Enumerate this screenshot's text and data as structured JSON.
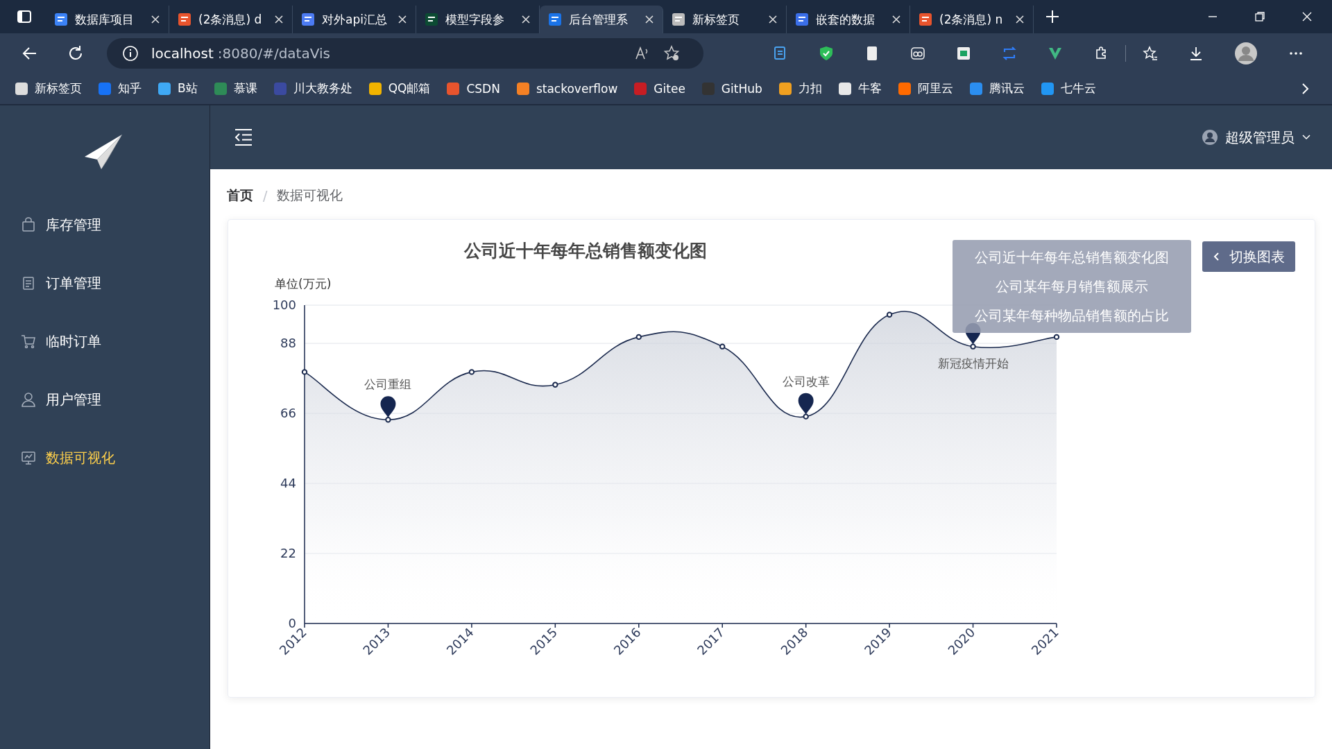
{
  "browser": {
    "tabs": [
      {
        "title": "数据库项目",
        "selected": false
      },
      {
        "title": "(2条消息) d",
        "selected": false
      },
      {
        "title": "对外api汇总",
        "selected": false
      },
      {
        "title": "模型字段参",
        "selected": false
      },
      {
        "title": "后台管理系",
        "selected": true
      },
      {
        "title": "新标签页",
        "selected": false
      },
      {
        "title": "嵌套的数据",
        "selected": false
      },
      {
        "title": "(2条消息) n",
        "selected": false
      }
    ],
    "address": {
      "host": "localhost",
      "path": ":8080/#/dataVis"
    },
    "bookmarks": [
      "新标签页",
      "知乎",
      "B站",
      "慕课",
      "川大教务处",
      "QQ邮箱",
      "CSDN",
      "stackoverflow",
      "Gitee",
      "GitHub",
      "力扣",
      "牛客",
      "阿里云",
      "腾讯云",
      "七牛云"
    ]
  },
  "sidebar": {
    "items": [
      {
        "label": "库存管理",
        "selected": false
      },
      {
        "label": "订单管理",
        "selected": false
      },
      {
        "label": "临时订单",
        "selected": false
      },
      {
        "label": "用户管理",
        "selected": false
      },
      {
        "label": "数据可视化",
        "selected": true
      }
    ]
  },
  "header": {
    "user": "超级管理员"
  },
  "breadcrumb": {
    "items": [
      "首页",
      "数据可视化"
    ],
    "separator": "/"
  },
  "chart_menu": {
    "items": [
      "公司近十年每年总销售额变化图",
      "公司某年每月销售额展示",
      "公司某年每种物品销售额的占比"
    ],
    "button": "切换图表"
  },
  "chart": {
    "chart_data": {
      "type": "area",
      "title": "公司近十年每年总销售额变化图",
      "ylabel": "单位(万元)",
      "categories": [
        "2012",
        "2013",
        "2014",
        "2015",
        "2016",
        "2017",
        "2018",
        "2019",
        "2020",
        "2021"
      ],
      "values": [
        79,
        64,
        79,
        75,
        90,
        87,
        65,
        97,
        87,
        90
      ],
      "ylim": [
        0,
        100
      ],
      "yticks": [
        0,
        22,
        44,
        66,
        88,
        100
      ],
      "grid": true,
      "annotations": [
        {
          "x": "2013",
          "y": 64,
          "text": "公司重组"
        },
        {
          "x": "2018",
          "y": 65,
          "text": "公司改革"
        },
        {
          "x": "2020",
          "y": 87,
          "text": "新冠疫情开始"
        }
      ]
    }
  }
}
